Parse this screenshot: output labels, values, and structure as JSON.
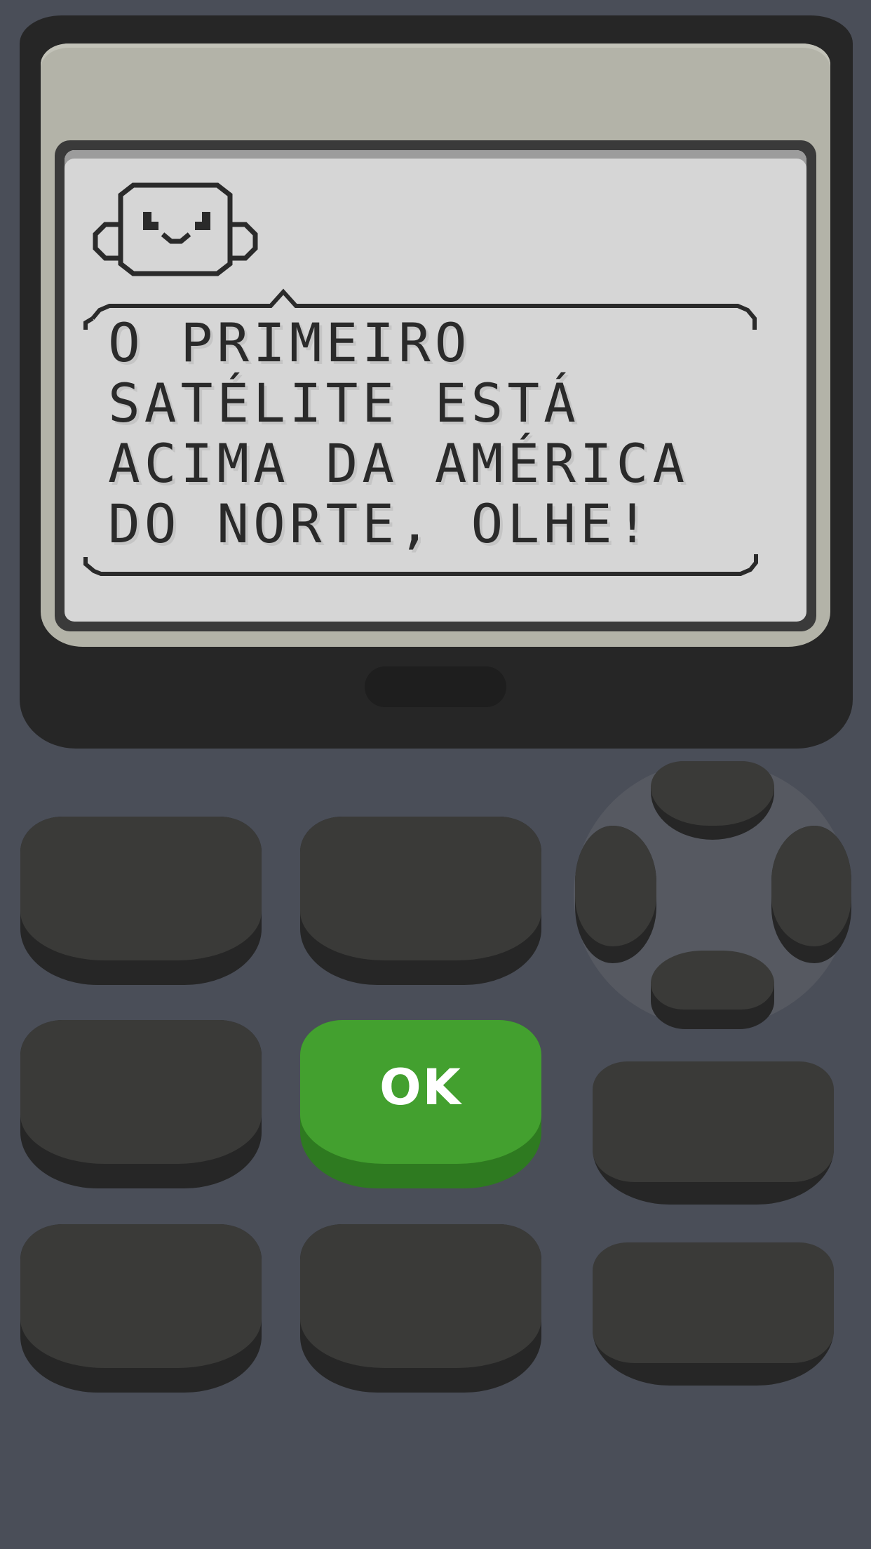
{
  "screen": {
    "message_lines": [
      "O PRIMEIRO",
      "SATÉLITE ESTÁ",
      "ACIMA DA AMÉRICA",
      "DO NORTE, OLHE!"
    ],
    "character_icon": "robot-face-icon"
  },
  "keypad": {
    "ok_label": "OK"
  },
  "colors": {
    "background": "#4a4e58",
    "housing": "#262626",
    "bezel": "#b3b3a8",
    "lcd": "#d6d6d6",
    "lcd_text": "#2a2a2a",
    "key": "#3a3a38",
    "key_shadow": "#262626",
    "ok_key": "#43a02f",
    "ok_key_shadow": "#2e7a20",
    "dpad_base": "#565961"
  }
}
